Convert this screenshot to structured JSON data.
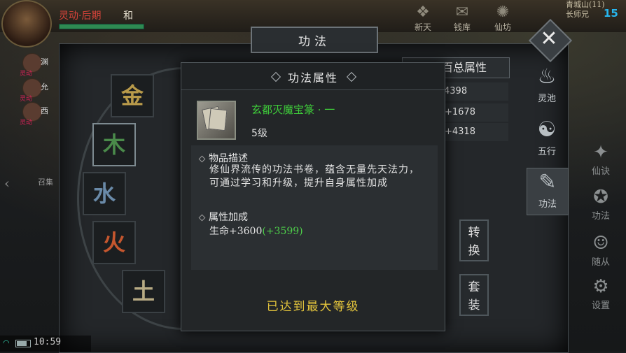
{
  "hud": {
    "player_name": "灵动·后期",
    "player_stance": "和",
    "counter": "15",
    "topright_text": "青城山(11)\n长师兄",
    "top_icons": [
      {
        "icon": "newday-icon",
        "label": "新天"
      },
      {
        "icon": "treasure-icon",
        "label": "钱库"
      },
      {
        "icon": "immortal-icon",
        "label": "仙坊"
      }
    ],
    "party": [
      {
        "name": "渊",
        "tag": "灵动"
      },
      {
        "name": "允",
        "tag": "灵动"
      },
      {
        "name": "西",
        "tag": "灵动"
      }
    ],
    "summon_label": "召集",
    "clock": "10:59"
  },
  "panel": {
    "title": "功法",
    "elements": [
      "金",
      "木",
      "水",
      "火",
      "土"
    ],
    "selected_element": "木",
    "stats_header": "百总属性",
    "stat_lines": [
      "4398",
      "合+1678",
      "御+4318"
    ],
    "convert_button": [
      "转",
      "换"
    ],
    "set_button": [
      "套",
      "装"
    ]
  },
  "sidebar": [
    {
      "icon": "spirit-pool-icon",
      "label": "灵池",
      "active": false
    },
    {
      "icon": "five-elements-icon",
      "label": "五行",
      "active": false
    },
    {
      "icon": "scroll-icon",
      "label": "功法",
      "active": true
    }
  ],
  "sidebar2": [
    {
      "icon": "immortal-art-icon",
      "label": "仙诀"
    },
    {
      "icon": "skill-icon",
      "label": "功法"
    },
    {
      "icon": "follower-icon",
      "label": "随从"
    },
    {
      "icon": "settings-icon",
      "label": "设置"
    }
  ],
  "dialog": {
    "title": "功法属性",
    "item_name": "玄都灭魔宝篆 · 一",
    "item_level": "5级",
    "desc_heading": "物品描述",
    "desc_text": "修仙界流传的功法书卷，蕴含无量先天法力，可通过学习和升级，提升自身属性加成",
    "attr_heading": "属性加成",
    "attr_value": "生命+3600",
    "attr_bonus": "(+3599)",
    "max_level_text": "已达到最大等级"
  },
  "colors": {
    "item_name": "#3fcf3a",
    "bonus": "#4ecf4a",
    "max_level": "#e3c43c",
    "counter": "#27b7f0"
  }
}
